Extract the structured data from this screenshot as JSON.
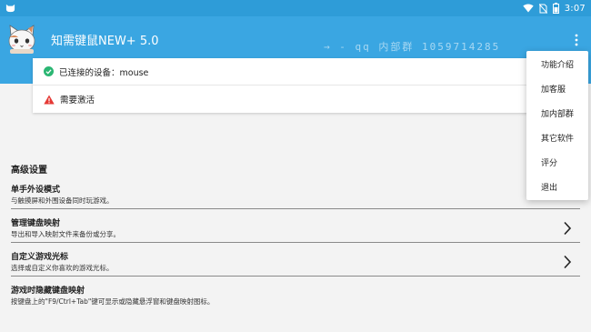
{
  "status_bar": {
    "time": "3:07"
  },
  "app_bar": {
    "title": "知需键鼠NEW+ 5.0",
    "watermark": "→ - qq 内部群 1059714285"
  },
  "status_card": {
    "connected_text": "已连接的设备：mouse",
    "activation_text": "需要激活"
  },
  "settings": {
    "section_title": "高级设置",
    "items": [
      {
        "title": "单手外设模式",
        "desc": "与触摸屏和外围设备同时玩游戏。"
      },
      {
        "title": "管理键盘映射",
        "desc": "导出和导入映射文件来备份或分享。"
      },
      {
        "title": "自定义游戏光标",
        "desc": "选择或自定义你喜欢的游戏光标。"
      },
      {
        "title": "游戏时隐藏键盘映射",
        "desc": "按键盘上的\"F9/Ctrl+Tab\"键可显示或隐藏悬浮窗和键盘映射图标。"
      }
    ]
  },
  "overflow_menu": {
    "items": [
      "功能介绍",
      "加客服",
      "加内部群",
      "其它软件",
      "评分",
      "退出"
    ]
  },
  "colors": {
    "app_bar": "#3aa6e2",
    "status_bar": "#2e9cd8",
    "success": "#2bb673",
    "warning": "#e53935"
  }
}
